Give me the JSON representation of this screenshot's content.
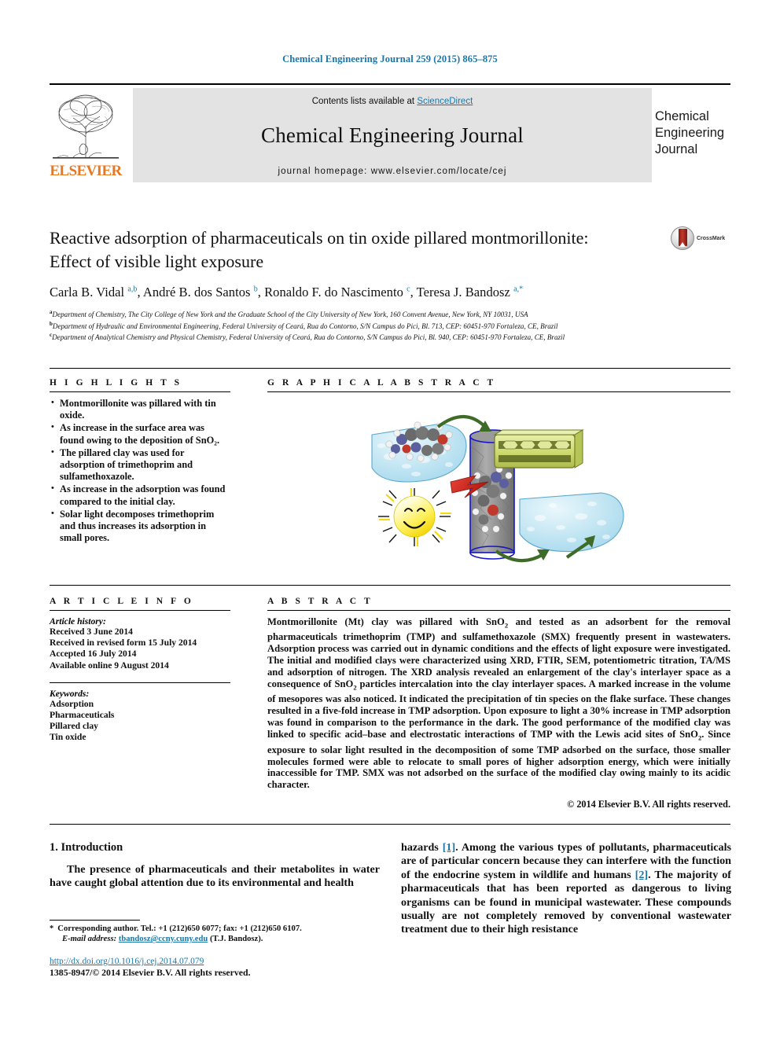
{
  "running_head": "Chemical Engineering Journal 259 (2015) 865–875",
  "masthead": {
    "contents_prefix": "Contents lists available at ",
    "sciencedirect": "ScienceDirect",
    "journal_title": "Chemical Engineering Journal",
    "homepage": "journal homepage: www.elsevier.com/locate/cej",
    "publisher": "ELSEVIER",
    "cover_title": "Chemical Engineering Journal",
    "accent_color": "#1b76a8",
    "elsevier_orange": "#e87722"
  },
  "article": {
    "title": "Reactive adsorption of pharmaceuticals on tin oxide pillared montmorillonite: Effect of visible light exposure",
    "crossmark_label": "CrossMark",
    "authors_html": "Carla B. Vidal <sup>a,b</sup>, André B. dos Santos <sup>b</sup>, Ronaldo F. do Nascimento <sup>c</sup>, Teresa J. Bandosz <sup>a,*</sup>",
    "affiliations": [
      {
        "marker": "a",
        "text": "Department of Chemistry, The City College of New York and the Graduate School of the City University of New York, 160 Convent Avenue, New York, NY 10031, USA"
      },
      {
        "marker": "b",
        "text": "Department of Hydraulic and Environmental Engineering, Federal University of Ceará, Rua do Contorno, S/N Campus do Pici, Bl. 713, CEP: 60451-970 Fortaleza, CE, Brazil"
      },
      {
        "marker": "c",
        "text": "Department of Analytical Chemistry and Physical Chemistry, Federal University of Ceará, Rua do Contorno, S/N Campus do Pici, Bl. 940, CEP: 60451-970 Fortaleza, CE, Brazil"
      }
    ]
  },
  "highlights": {
    "heading": "H I G H L I G H T S",
    "items": [
      "Montmorillonite was pillared with tin oxide.",
      "As increase in the surface area was found owing to the deposition of SnO₂.",
      "The pillared clay was used for adsorption of trimethoprim and sulfamethoxazole.",
      "As increase in the adsorption was found compared to the initial clay.",
      "Solar light decomposes trimethoprim and thus increases its adsorption in small pores."
    ]
  },
  "graphical_abstract": {
    "heading": "G R A P H I C A L   A B S T R A C T",
    "elements": [
      "clay-flake-left",
      "sun-icon",
      "sem-cylinder",
      "pillared-layer-block",
      "red-lightning-arrow",
      "clay-flake-right",
      "molecule-model",
      "green-curved-arrows"
    ]
  },
  "article_info": {
    "heading": "A R T I C L E   I N F O",
    "history_label": "Article history:",
    "history": [
      "Received 3 June 2014",
      "Received in revised form 15 July 2014",
      "Accepted 16 July 2014",
      "Available online 9 August 2014"
    ],
    "keywords_label": "Keywords:",
    "keywords": [
      "Adsorption",
      "Pharmaceuticals",
      "Pillared clay",
      "Tin oxide"
    ]
  },
  "abstract": {
    "heading": "A B S T R A C T",
    "paragraph_1": "Montmorillonite (Mt) clay was pillared with SnO",
    "paragraph_2": " and tested as an adsorbent for the removal pharmaceuticals trimethoprim (TMP) and sulfamethoxazole (SMX) frequently present in wastewaters. Adsorption process was carried out in dynamic conditions and the effects of light exposure were investigated. The initial and modified clays were characterized using XRD, FTIR, SEM, potentiometric titration, TA/MS and adsorption of nitrogen. The XRD analysis revealed an enlargement of the clay's interlayer space as a consequence of SnO",
    "paragraph_3": " particles intercalation into the clay interlayer spaces. A marked increase in the volume of mesopores was also noticed. It indicated the precipitation of tin species on the flake surface. These changes resulted in a five-fold increase in TMP adsorption. Upon exposure to light a 30% increase in TMP adsorption was found in comparison to the performance in the dark. The good performance of the modified clay was linked to specific acid–base and electrostatic interactions of TMP with the Lewis acid sites of SnO",
    "paragraph_4": ". Since exposure to solar light resulted in the decomposition of some TMP adsorbed on the surface, those smaller molecules formed were able to relocate to small pores of higher adsorption energy, which were initially inaccessible for TMP. SMX was not adsorbed on the surface of the modified clay owing mainly to its acidic character.",
    "copyright": "© 2014 Elsevier B.V. All rights reserved."
  },
  "introduction": {
    "heading": "1. Introduction",
    "left_paragraph": "The presence of pharmaceuticals and their metabolites in water have caught global attention due to its environmental and health",
    "right_paragraph_a": "hazards ",
    "right_ref_1": "[1]",
    "right_paragraph_b": ". Among the various types of pollutants, pharmaceuticals are of particular concern because they can interfere with the function of the endocrine system in wildlife and humans ",
    "right_ref_2": "[2]",
    "right_paragraph_c": ". The majority of pharmaceuticals that has been reported as dangerous to living organisms can be found in municipal wastewater. These compounds usually are not completely removed by conventional wastewater treatment due to their high resistance"
  },
  "footnote": {
    "star": "*",
    "corresponding": "Corresponding author. Tel.: +1 (212)650 6077; fax: +1 (212)650 6107.",
    "email_label": "E-mail address:",
    "email": "tbandosz@ccny.cuny.edu",
    "email_owner": "(T.J. Bandosz)."
  },
  "footer": {
    "doi": "http://dx.doi.org/10.1016/j.cej.2014.07.079",
    "issn_line": "1385-8947/© 2014 Elsevier B.V. All rights reserved."
  }
}
